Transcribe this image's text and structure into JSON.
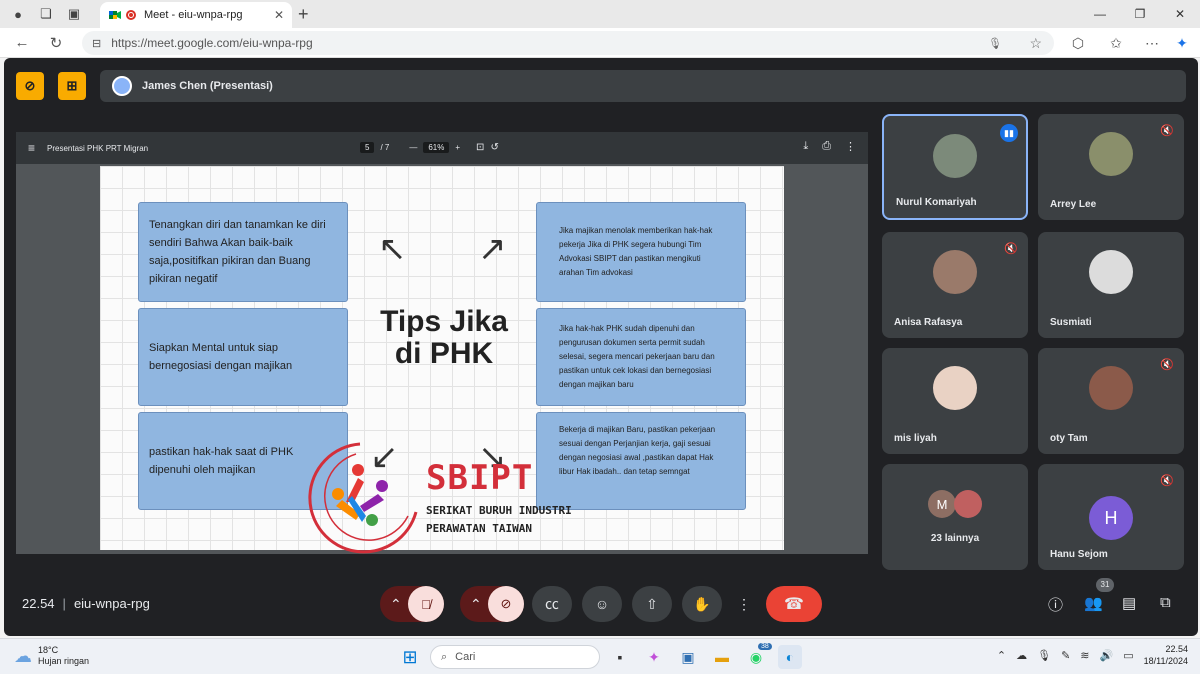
{
  "browser": {
    "tab_title": "Meet - eiu-wnpa-rpg",
    "url": "https://meet.google.com/eiu-wnpa-rpg"
  },
  "meet": {
    "presenter": "James Chen (Presentasi)",
    "time": "22.54",
    "meeting_code": "eiu-wnpa-rpg",
    "participant_count": "31"
  },
  "viewer": {
    "doc_name": "Presentasi PHK PRT Migran",
    "page_current": "5",
    "page_total": "/ 7",
    "zoom": "61%"
  },
  "slide": {
    "title_line1": "Tips Jika",
    "title_line2": "di PHK",
    "left_cards": [
      "Tenangkan diri dan tanamkan ke diri sendiri Bahwa Akan baik-baik saja,positifkan pikiran dan Buang pikiran negatif",
      "Siapkan Mental untuk siap bernegosiasi dengan majikan",
      "pastikan hak-hak saat di PHK dipenuhi oleh majikan"
    ],
    "right_cards": [
      "Jika majikan menolak memberikan hak-hak pekerja Jika di PHK segera hubungi Tim Advokasi SBIPT dan pastikan mengikuti arahan Tim advokasi",
      "Jika hak-hak PHK sudah dipenuhi dan pengurusan dokumen serta permit sudah selesai, segera mencari pekerjaan baru dan pastikan untuk cek lokasi dan bernegosiasi dengan majikan baru",
      "Bekerja di majikan Baru, pastikan pekerjaan sesuai dengan Perjanjian kerja, gaji sesuai dengan negosiasi awal ,pastikan dapat Hak libur Hak ibadah.. dan tetap semngat"
    ],
    "logo_text": "SBIPT",
    "logo_sub1": "SERIKAT BURUH INDUSTRI",
    "logo_sub2": "PERAWATAN TAIWAN"
  },
  "participants": [
    {
      "name": "Nurul Komariyah",
      "speaking": true
    },
    {
      "name": "Arrey Lee",
      "muted": true
    },
    {
      "name": "Anisa Rafasya",
      "muted": true
    },
    {
      "name": "Susmiati"
    },
    {
      "name": "mis liyah"
    },
    {
      "name": "oty Tam",
      "muted": true
    },
    {
      "name": "23 lainnya",
      "avatar_letter": "M"
    },
    {
      "name": "Hanu Sejom",
      "muted": true,
      "avatar_letter": "H"
    }
  ],
  "taskbar": {
    "weather_temp": "18°C",
    "weather_desc": "Hujan ringan",
    "search_placeholder": "Cari",
    "whatsapp_badge": "38",
    "time": "22.54",
    "date": "18/11/2024"
  },
  "colors": {
    "meet_bg": "#202124",
    "tile_bg": "#3c4043",
    "accent_blue": "#8ab4f8",
    "end_call": "#ea4335",
    "card_blue": "#90b6e0",
    "logo_red": "#d32f3a"
  }
}
